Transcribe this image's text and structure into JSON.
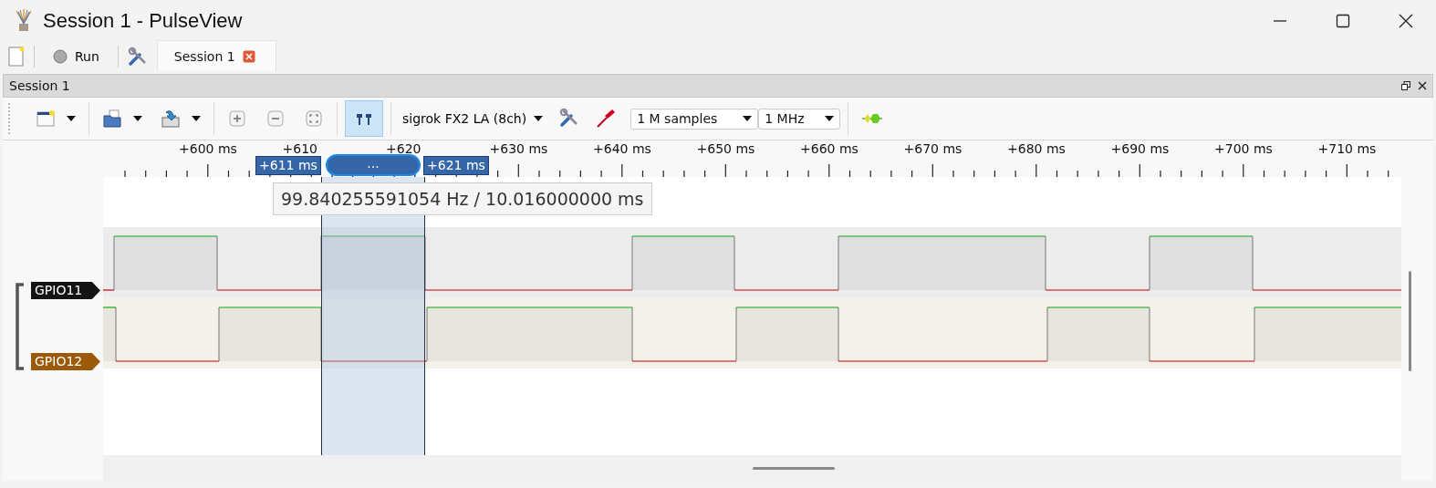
{
  "window": {
    "title": "Session 1 - PulseView"
  },
  "main_toolbar": {
    "run_label": "Run",
    "tabs": [
      {
        "label": "Session 1",
        "selected": true
      }
    ]
  },
  "session_panel": {
    "title": "Session 1"
  },
  "session_toolbar": {
    "cursors_on": true,
    "device": "sigrok FX2 LA (8ch)",
    "samples": "1 M samples",
    "samplerate": "1 MHz"
  },
  "ruler": {
    "labels": [
      "+600 ms",
      "+610",
      "+620",
      "+630 ms",
      "+640 ms",
      "+650 ms",
      "+660 ms",
      "+670 ms",
      "+680 ms",
      "+690 ms",
      "+700 ms",
      "+710 ms"
    ],
    "cursor_start": "+611 ms",
    "cursor_handle": "...",
    "cursor_end": "+621 ms"
  },
  "cursor_tooltip": "99.840255591054 Hz / 10.016000000 ms",
  "channels": [
    {
      "name": "GPIO11",
      "color": "#141414"
    },
    {
      "name": "GPIO12",
      "color": "#9b5a0a"
    }
  ]
}
